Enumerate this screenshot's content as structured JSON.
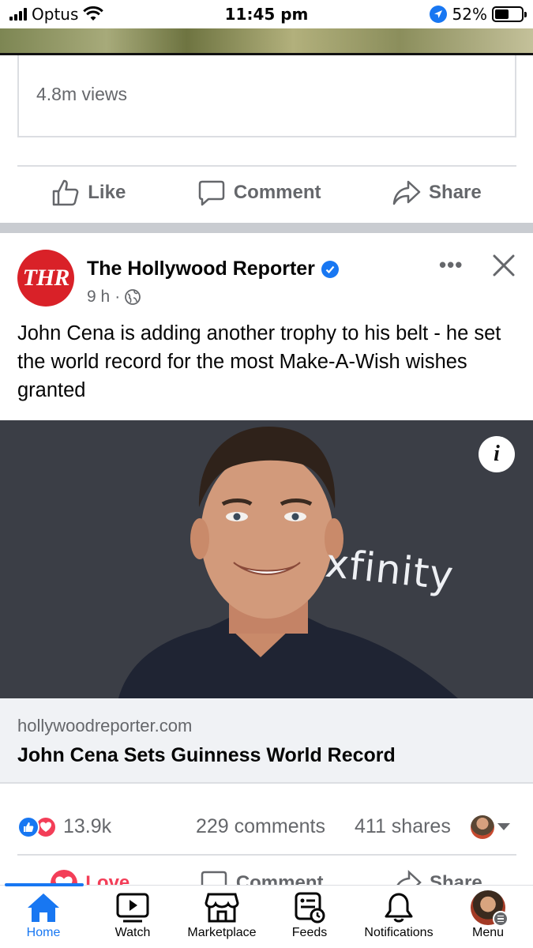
{
  "status_bar": {
    "carrier": "Optus",
    "time": "11:45 pm",
    "battery": "52%",
    "battery_level": 0.52
  },
  "previous_post": {
    "views": "4.8m views",
    "actions": {
      "like": "Like",
      "comment": "Comment",
      "share": "Share"
    }
  },
  "post": {
    "page_name": "The Hollywood Reporter",
    "avatar_text": "THR",
    "time": "9 h",
    "meta_separator": "·",
    "more": "•••",
    "text": "John Cena is adding another trophy to his belt - he set the world record for the most Make-A-Wish wishes granted",
    "image": {
      "sign_text": "xfinity",
      "info": "i"
    },
    "link": {
      "domain": "hollywoodreporter.com",
      "title": "John Cena Sets Guinness World Record"
    },
    "reactions": {
      "count": "13.9k",
      "comments": "229 comments",
      "shares": "411 shares"
    },
    "actions": {
      "love": "Love",
      "comment": "Comment",
      "share": "Share"
    }
  },
  "bottom_nav": {
    "items": [
      {
        "label": "Home",
        "icon": "home-icon"
      },
      {
        "label": "Watch",
        "icon": "watch-icon"
      },
      {
        "label": "Marketplace",
        "icon": "marketplace-icon"
      },
      {
        "label": "Feeds",
        "icon": "feeds-icon"
      },
      {
        "label": "Notifications",
        "icon": "bell-icon"
      },
      {
        "label": "Menu",
        "icon": "profile-avatar"
      }
    ]
  },
  "colors": {
    "accent": "#1877f2",
    "love": "#f33e58",
    "thr_red": "#d92128",
    "muted": "#65676b"
  }
}
